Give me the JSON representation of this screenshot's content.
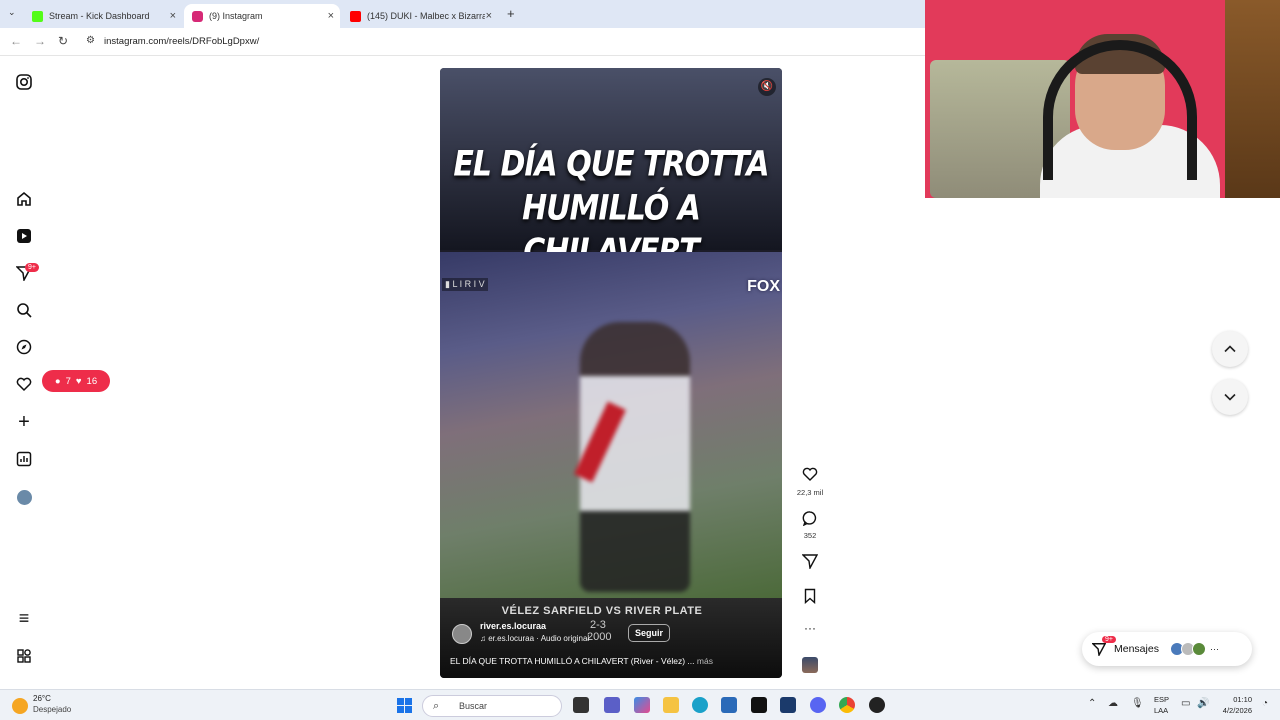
{
  "browser": {
    "tabs": [
      {
        "title": "Stream - Kick Dashboard",
        "favicon_color": "#53fc18"
      },
      {
        "title": "(9) Instagram",
        "favicon_color": "#d62976"
      },
      {
        "title": "(145) DUKI - Malbec x Bizarrap",
        "favicon_color": "#ff0000"
      }
    ],
    "new_tab": "+",
    "url": "instagram.com/reels/DRFobLgDpxw/"
  },
  "sidebar": {
    "notifications_badge": "9+",
    "icons": [
      "instagram-logo",
      "home",
      "reels",
      "messages",
      "search",
      "explore",
      "notifications",
      "create",
      "dashboard",
      "profile",
      "more",
      "also-from-meta"
    ]
  },
  "notification_pill": {
    "comments": "7",
    "likes": "16"
  },
  "reel": {
    "headline_line1": "EL DÍA QUE TROTTA",
    "headline_line2": "HUMILLÓ A CHILAVERT",
    "broadcaster": "FOX",
    "match_title": "VÉLEZ SARFIELD VS RIVER PLATE",
    "score": "2-3",
    "year": "2000",
    "username": "river.es.locuraa",
    "audio": "♫ er.es.locuraa · Audio original",
    "follow_label": "Seguir",
    "caption": "EL DÍA QUE TROTTA HUMILLÓ A CHILAVERT (River - Vélez) ...",
    "caption_more": "más"
  },
  "actions": {
    "likes": "22,3 mil",
    "comments": "352"
  },
  "messages": {
    "label": "Mensajes",
    "badge": "9+"
  },
  "taskbar": {
    "temperature": "26°C",
    "weather": "Despejado",
    "search_placeholder": "Buscar",
    "lang_line1": "ESP",
    "lang_line2": "LAA",
    "time": "01:10",
    "date": "4/2/2026"
  }
}
